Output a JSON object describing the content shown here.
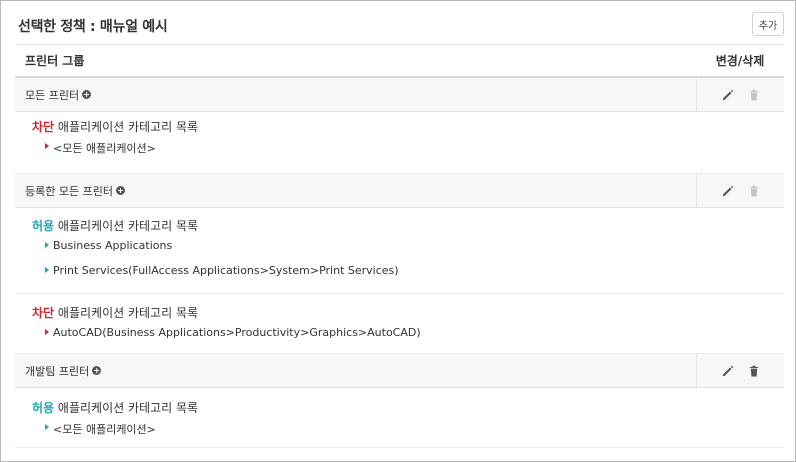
{
  "title": "선택한 정책 : 매뉴얼 예시",
  "add_button": "추가",
  "table": {
    "col_group": "프린터 그룹",
    "col_actions": "변경/삭제"
  },
  "groups": [
    {
      "name": "모든 프린터",
      "delete_enabled": false,
      "sections": [
        {
          "type": "차단",
          "label": "애플리케이션 카테고리 목록",
          "items": [
            "<모든 애플리케이션>"
          ]
        }
      ]
    },
    {
      "name": "등록한 모든 프린터",
      "delete_enabled": false,
      "sections": [
        {
          "type": "허용",
          "label": "애플리케이션 카테고리 목록",
          "items": [
            "Business Applications",
            "Print Services(FullAccess Applications>System>Print Services)"
          ]
        },
        {
          "type": "차단",
          "label": "애플리케이션 카테고리 목록",
          "items": [
            "AutoCAD(Business Applications>Productivity>Graphics>AutoCAD)"
          ]
        }
      ]
    },
    {
      "name": "개발팀 프린터",
      "delete_enabled": true,
      "sections": [
        {
          "type": "허용",
          "label": "애플리케이션 카테고리 목록",
          "items": [
            "<모든 애플리케이션>"
          ]
        }
      ]
    }
  ],
  "colors": {
    "block": "#d6262c",
    "allow": "#1ba6b7",
    "icon_active": "#555555",
    "icon_disabled": "#c4c4c4"
  }
}
